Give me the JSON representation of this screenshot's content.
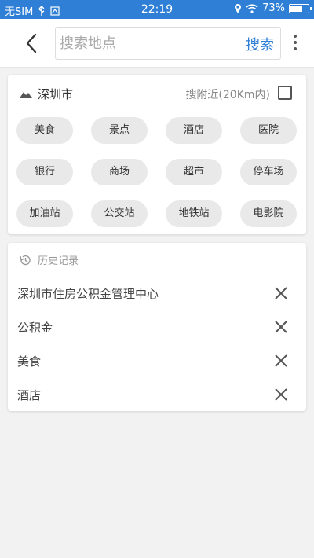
{
  "status": {
    "sim": "无SIM",
    "time": "22:19",
    "battery": "73%",
    "battery_level": 0.73
  },
  "search": {
    "placeholder": "搜索地点",
    "button": "搜索"
  },
  "location": {
    "city": "深圳市",
    "nearby_label": "搜附近(20Km内)"
  },
  "categories": [
    "美食",
    "景点",
    "酒店",
    "医院",
    "银行",
    "商场",
    "超市",
    "停车场",
    "加油站",
    "公交站",
    "地铁站",
    "电影院"
  ],
  "history": {
    "title": "历史记录",
    "items": [
      "深圳市住房公积金管理中心",
      "公积金",
      "美食",
      "酒店"
    ]
  },
  "colors": {
    "accent": "#2f7fd6",
    "chip_bg": "#e9e9e9",
    "page_bg": "#f2f2f2"
  }
}
